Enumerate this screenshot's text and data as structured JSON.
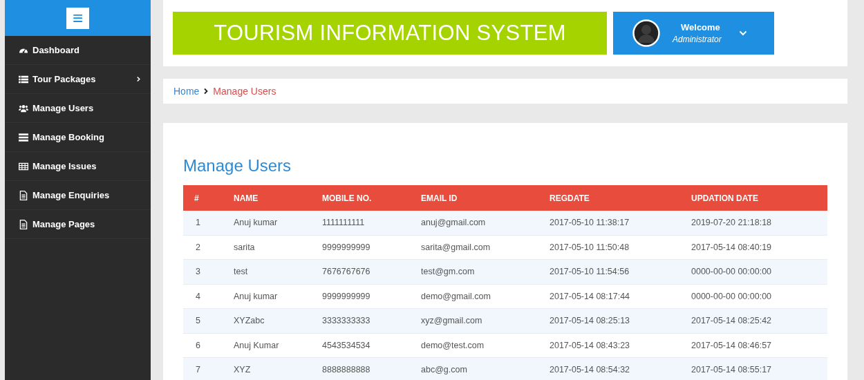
{
  "sidebar": {
    "menu_button": "≡",
    "items": [
      {
        "label": "Dashboard",
        "expandable": false
      },
      {
        "label": "Tour Packages",
        "expandable": true
      },
      {
        "label": "Manage Users",
        "expandable": false
      },
      {
        "label": "Manage Booking",
        "expandable": false
      },
      {
        "label": "Manage Issues",
        "expandable": false
      },
      {
        "label": "Manage Enquiries",
        "expandable": false
      },
      {
        "label": "Manage Pages",
        "expandable": false
      }
    ]
  },
  "header": {
    "title": "TOURISM INFORMATION SYSTEM",
    "user": {
      "greeting": "Welcome",
      "role": "Administrator"
    }
  },
  "breadcrumb": {
    "home": "Home",
    "current": "Manage Users"
  },
  "page_title": "Manage Users",
  "table": {
    "columns": [
      "#",
      "NAME",
      "MOBILE NO.",
      "EMAIL ID",
      "REGDATE",
      "UPDATION DATE"
    ],
    "rows": [
      [
        "1",
        "Anuj kumar",
        "1111111111",
        "anuj@gmail.com",
        "2017-05-10 11:38:17",
        "2019-07-20 21:18:18"
      ],
      [
        "2",
        "sarita",
        "9999999999",
        "sarita@gmail.com",
        "2017-05-10 11:50:48",
        "2017-05-14 08:40:19"
      ],
      [
        "3",
        "test",
        "7676767676",
        "test@gm.com",
        "2017-05-10 11:54:56",
        "0000-00-00 00:00:00"
      ],
      [
        "4",
        "Anuj kumar",
        "9999999999",
        "demo@gmail.com",
        "2017-05-14 08:17:44",
        "0000-00-00 00:00:00"
      ],
      [
        "5",
        "XYZabc",
        "3333333333",
        "xyz@gmail.com",
        "2017-05-14 08:25:13",
        "2017-05-14 08:25:42"
      ],
      [
        "6",
        "Anuj Kumar",
        "4543534534",
        "demo@test.com",
        "2017-05-14 08:43:23",
        "2017-05-14 08:46:57"
      ],
      [
        "7",
        "XYZ",
        "8888888888",
        "abc@g.com",
        "2017-05-14 08:54:32",
        "2017-05-14 08:55:17"
      ]
    ]
  }
}
